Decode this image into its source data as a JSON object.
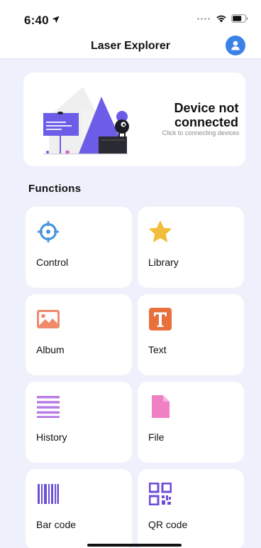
{
  "status_bar": {
    "time": "6:40"
  },
  "header": {
    "title": "Laser Explorer"
  },
  "device": {
    "status_title": "Device not connected",
    "hint": "Click to connecting devices"
  },
  "functions": {
    "title": "Functions",
    "items": [
      {
        "label": "Control",
        "icon": "crosshair-icon",
        "color": "#4b94d9"
      },
      {
        "label": "Library",
        "icon": "star-icon",
        "color": "#f2bd3a"
      },
      {
        "label": "Album",
        "icon": "image-icon",
        "color": "#ef8a6b"
      },
      {
        "label": "Text",
        "icon": "text-t-icon",
        "color": "#e8703a"
      },
      {
        "label": "History",
        "icon": "list-lines-icon",
        "color": "#b77ae6"
      },
      {
        "label": "File",
        "icon": "file-icon",
        "color": "#f07fc4"
      },
      {
        "label": "Bar code",
        "icon": "barcode-icon",
        "color": "#6a4ed6"
      },
      {
        "label": "QR code",
        "icon": "qrcode-icon",
        "color": "#6a4ed6"
      }
    ]
  },
  "colors": {
    "accent": "#3b82e8",
    "background": "#eef1fb"
  }
}
